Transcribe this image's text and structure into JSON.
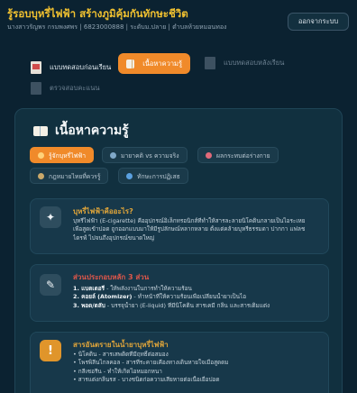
{
  "header": {
    "title": "รู้รอบบุหรี่ไฟฟ้า สร้างภูมิคุ้มกันทักษะชีวิต",
    "user_info": "นางสาวรัญพร กรมพงศพร | 6823000888 | ระดับม.ปลาย | ตำบลห้วยหมอนทอง",
    "logout_label": "ออกจากระบบ"
  },
  "nav": {
    "items": [
      {
        "label": "แบบทดสอบก่อนเรียน",
        "icon": "document-icon",
        "state": "normal"
      },
      {
        "label": "เนื้อหาความรู้",
        "icon": "book-icon",
        "state": "active"
      },
      {
        "label": "แบบทดสอบหลังเรียน",
        "icon": "document-icon",
        "state": "disabled"
      },
      {
        "label": "ตรวจสอบคะแนน",
        "icon": "chart-icon",
        "state": "disabled"
      }
    ]
  },
  "content": {
    "title": "เนื้อหาความรู้",
    "tabs": [
      {
        "label": "รู้จักบุหรี่ไฟฟ้า",
        "icon": "dot-icon",
        "active": true
      },
      {
        "label": "มายาคติ vs ความจริง",
        "icon": "search-icon",
        "active": false
      },
      {
        "label": "ผลกระทบต่อร่างกาย",
        "icon": "heart-icon",
        "active": false
      },
      {
        "label": "กฎหมายไทยที่ควรรู้",
        "icon": "law-icon",
        "active": false
      },
      {
        "label": "ทักษะการปฏิเสธ",
        "icon": "shield-icon",
        "active": false
      }
    ],
    "sections": [
      {
        "title": "บุหรี่ไฟฟ้าคืออะไร?",
        "icon": "cigarette-icon",
        "lines": [
          "บุหรี่ไฟฟ้า (E-cigarette) คืออุปกรณ์อิเล็กทรอนิกส์ที่ทำให้สารละลายนิโคตินกลายเป็นไอระเหย",
          "เพื่อสูดเข้าปอด ถูกออกแบบมาให้มีรูปลักษณ์หลากหลาย ตั้งแต่คล้ายบุหรี่ธรรมดา ปากกา แฟลช",
          "ไดรฟ์ ไปจนถึงอุปกรณ์ขนาดใหญ่"
        ]
      },
      {
        "title": "ส่วนประกอบหลัก 3 ส่วน",
        "icon": "wrench-icon",
        "items": [
          {
            "bold": "1. แบตเตอรี่",
            "text": " - ให้พลังงานในการทำให้ความร้อน"
          },
          {
            "bold": "2. คอยล์ (Atomizer)",
            "text": " - ทำหน้าที่ให้ความร้อนเพื่อเปลี่ยนน้ำยาเป็นไอ"
          },
          {
            "bold": "3. พอด/ตลับ",
            "text": " - บรรจุน้ำยา (E-liquid) ที่มีนิโคติน สารเคมี กลิ่น และสารเติมแต่ง"
          }
        ]
      },
      {
        "title": "สารอันตรายในน้ำยาบุหรี่ไฟฟ้า",
        "icon": "warning-icon",
        "lines": [
          "• นิโคติน - สารเสพติดที่มีฤทธิ์ต่อสมอง",
          "• โพรพิลีนไกลคอล - สารที่ระคายเคืองทางเดินหายใจเมื่อสูดดม",
          "• กลีเซอรีน - ทำให้เกิดไอหมอกหนา",
          "• สารแต่งกลิ่นรส - บางชนิดก่อความเสียหายต่อเนื้อเยื่อปอด"
        ]
      }
    ]
  },
  "colors": {
    "background": "#0b2231",
    "accent": "#f08a2a",
    "title_yellow": "#f2c230",
    "card": "#11303f",
    "danger": "#e2574a"
  }
}
